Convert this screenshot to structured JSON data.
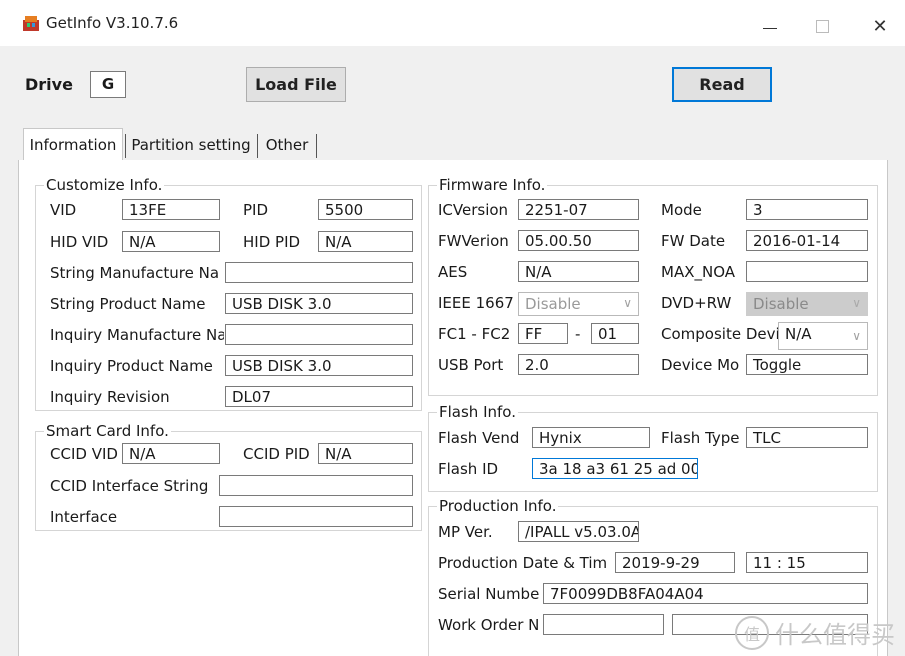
{
  "window": {
    "title": "GetInfo V3.10.7.6"
  },
  "toolbar": {
    "drive_label": "Drive",
    "drive_value": "G",
    "load_file": "Load File",
    "read": "Read"
  },
  "tabs": [
    "Information",
    "Partition setting",
    "Other"
  ],
  "customize": {
    "title": "Customize Info.",
    "vid_label": "VID",
    "vid": "13FE",
    "pid_label": "PID",
    "pid": "5500",
    "hid_vid_label": "HID VID",
    "hid_vid": "N/A",
    "hid_pid_label": "HID PID",
    "hid_pid": "N/A",
    "string_manufacture_label": "String Manufacture Na",
    "string_manufacture": "",
    "string_product_label": "String Product Name",
    "string_product": "USB DISK 3.0",
    "inquiry_manufacture_label": "Inquiry Manufacture Na",
    "inquiry_manufacture": "",
    "inquiry_product_label": "Inquiry Product Name",
    "inquiry_product": "USB DISK 3.0",
    "inquiry_revision_label": "Inquiry Revision",
    "inquiry_revision": "DL07"
  },
  "smartcard": {
    "title": "Smart Card Info.",
    "ccid_vid_label": "CCID VID",
    "ccid_vid": "N/A",
    "ccid_pid_label": "CCID PID",
    "ccid_pid": "N/A",
    "ccid_interface_label": "CCID Interface String",
    "ccid_interface": "",
    "interface_label": "Interface",
    "interface": ""
  },
  "firmware": {
    "title": "Firmware Info.",
    "icversion_label": "ICVersion",
    "icversion": "2251-07",
    "mode_label": "Mode",
    "mode": "3",
    "fwversion_label": "FWVerion",
    "fwversion": "05.00.50",
    "fwdate_label": "FW Date",
    "fwdate": "2016-01-14",
    "aes_label": "AES",
    "aes": "N/A",
    "maxnoa_label": "MAX_NOA",
    "maxnoa": "",
    "ieee_label": "IEEE 1667",
    "ieee": "Disable",
    "dvd_label": "DVD+RW",
    "dvd": "Disable",
    "fc_label": "FC1 - FC2",
    "fc1": "FF",
    "fc_dash": "-",
    "fc2": "01",
    "composite_label": "Composite Devi",
    "composite": "N/A",
    "usbport_label": "USB Port",
    "usbport": "2.0",
    "devicemode_label": "Device Mo",
    "devicemode": "Toggle"
  },
  "flash": {
    "title": "Flash Info.",
    "vendor_label": "Flash Vend",
    "vendor": "Hynix",
    "type_label": "Flash Type",
    "type": "TLC",
    "id_label": "Flash ID",
    "id": "3a 18 a3 61 25 ad 00"
  },
  "production": {
    "title": "Production Info.",
    "mpver_label": "MP Ver.",
    "mpver": "/IPALL v5.03.0A",
    "date_label": "Production Date & Tim",
    "date": "2019-9-29",
    "time": "11 : 15",
    "serial_label": "Serial Numbe",
    "serial": "7F0099DB8FA04A04",
    "workorder_label": "Work Order N",
    "workorder1": "",
    "workorder2": ""
  },
  "watermark": {
    "logo_char": "值",
    "text": "什么值得买"
  },
  "colors": {
    "accent": "#0078d7",
    "client_bg": "#f0f0f0",
    "disabled": "#cccccc"
  }
}
